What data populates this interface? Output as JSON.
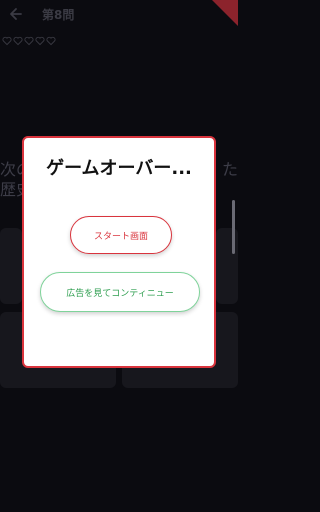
{
  "header": {
    "title": "第8問",
    "back_icon": "back-arrow-icon"
  },
  "status": {
    "lives_icons": [
      "heart-outline-icon",
      "heart-outline-icon",
      "heart-outline-icon",
      "heart-outline-icon",
      "heart-outline-icon"
    ]
  },
  "background": {
    "question_line1": "次の",
    "question_line1_end": "た",
    "question_line2": "歴史"
  },
  "modal": {
    "title": "ゲームオーバー...",
    "start_button": "スタート画面",
    "continue_button": "広告を見てコンティニュー"
  },
  "colors": {
    "accent": "#d9343d",
    "continue": "#2e9e4f",
    "background": "#0b0b10"
  }
}
